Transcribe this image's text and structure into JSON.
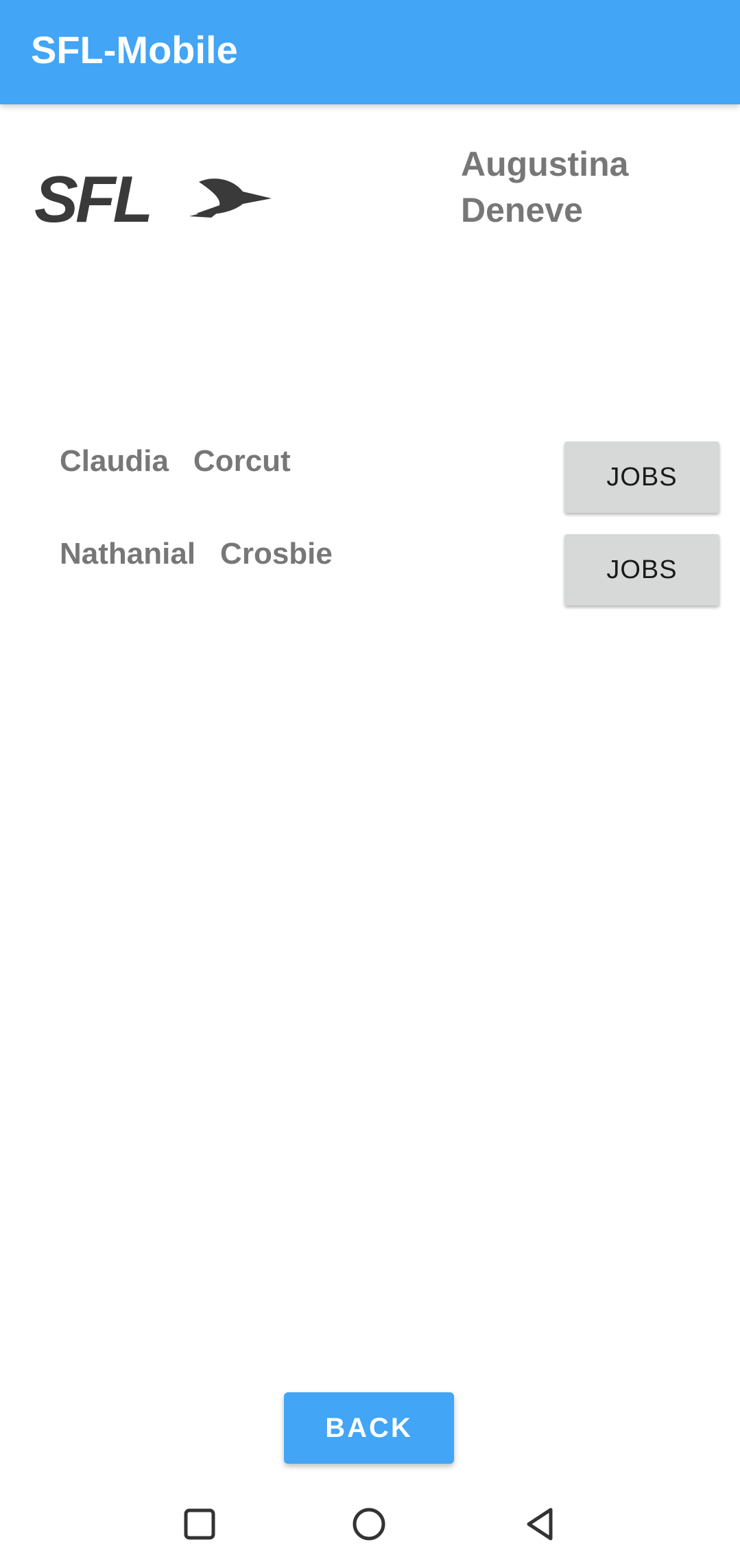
{
  "app": {
    "title": "SFL-Mobile",
    "accent_color": "#42a5f5"
  },
  "header": {
    "logo_text": "SFL",
    "logo_icon": "swallow-bird-icon",
    "logged_user": {
      "first_name": "Augustina",
      "last_name": "Deneve"
    }
  },
  "people": [
    {
      "first_name": "Claudia",
      "last_name": "Corcut",
      "button_label": "JOBS"
    },
    {
      "first_name": "Nathanial",
      "last_name": "Crosbie",
      "button_label": "JOBS"
    }
  ],
  "footer": {
    "back_label": "BACK"
  },
  "system_nav": {
    "icons": [
      "recents-square-icon",
      "home-circle-icon",
      "back-triangle-icon"
    ]
  }
}
